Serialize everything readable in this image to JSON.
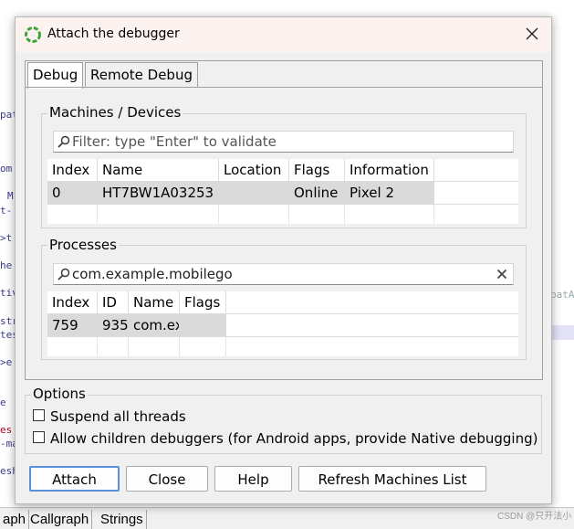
{
  "background": {
    "left_fragments": [
      "pat",
      "om",
      "M",
      "t-",
      ">t",
      "he",
      "tiv",
      "str",
      "tes",
      ">e",
      "e",
      "es",
      "-ma",
      "esh"
    ],
    "right_fragment": "patA",
    "bottom_tabs": [
      "aph",
      "Callgraph",
      "Strings"
    ],
    "watermark": "CSDN @只开法小"
  },
  "dialog": {
    "title": "Attach the debugger",
    "tabs": [
      {
        "label": "Debug",
        "active": true
      },
      {
        "label": "Remote Debug",
        "active": false
      }
    ],
    "machines": {
      "group_label": "Machines / Devices",
      "filter_placeholder": "Filter: type \"Enter\" to validate",
      "filter_value": "",
      "columns": [
        "Index",
        "Name",
        "Location",
        "Flags",
        "Information"
      ],
      "rows": [
        [
          "0",
          "HT7BW1A03253",
          "",
          "Online",
          "Pixel 2"
        ]
      ]
    },
    "processes": {
      "group_label": "Processes",
      "filter_value": "com.example.mobilego",
      "columns": [
        "Index",
        "ID",
        "Name",
        "Flags"
      ],
      "rows": [
        [
          "759",
          "935",
          "com.example.mobilego",
          ""
        ]
      ]
    },
    "options": {
      "group_label": "Options",
      "checkboxes": [
        {
          "label": "Suspend all threads",
          "checked": false
        },
        {
          "label": "Allow children debuggers (for Android apps, provide Native debugging)",
          "checked": false
        }
      ]
    },
    "buttons": {
      "attach": "Attach",
      "close": "Close",
      "help": "Help",
      "refresh": "Refresh Machines List"
    }
  }
}
